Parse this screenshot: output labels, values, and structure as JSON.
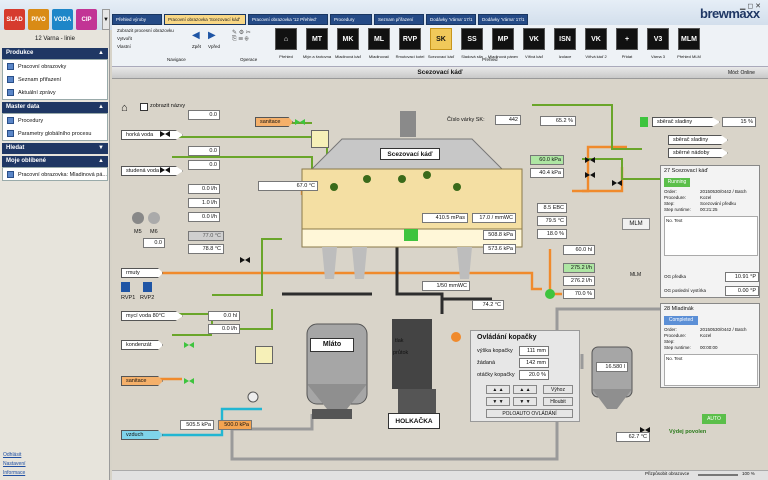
{
  "product_tabs": [
    {
      "label": "SLAD",
      "color": "#d63b2e"
    },
    {
      "label": "PIVO",
      "color": "#d98b16"
    },
    {
      "label": "VODA",
      "color": "#1e86c8"
    },
    {
      "label": "CIP",
      "color": "#c23495"
    }
  ],
  "product_tab_more": "▼",
  "sidebar": {
    "user": "12 Varna - linie",
    "production_header": "Produkce",
    "production_items": [
      "Pracovní obrazovky",
      "Seznam přiřazení",
      "Aktuální zprávy"
    ],
    "masterdata_header": "Master data",
    "masterdata_items": [
      "Procedury",
      "Parametry globálního procesu"
    ],
    "search_header": "Hledat",
    "favorites_header": "Moje oblíbené",
    "favorites_items": [
      "Pracovní obrazovka: Mladinová pá..."
    ],
    "links": [
      "Odhlásit",
      "Nastavení",
      "Informace"
    ]
  },
  "tabs": [
    "Přehled výroby",
    "Pracovní obrazovka 'Scezovací káď'",
    "Pracovní obrazovka '12 Přehled'",
    "Procedury",
    "Seznam přiřazení",
    "Dodávky 'Várna' 17/1",
    "Dodávky 'Várna' 17/1"
  ],
  "logo": "brewmaxx",
  "ribbon": {
    "left_items": [
      "Zobrazit procesní obrazovku",
      "Vytvořit",
      "Vlastní"
    ],
    "nav": {
      "back": "Zpět",
      "forward": "Vpřed"
    },
    "section_labels": [
      "Navigace",
      "Operace",
      "Přehled"
    ],
    "buttons": [
      {
        "icon": "⌂",
        "label": "Přehled"
      },
      {
        "icon": "MT",
        "label": "Mlýn a šrotovna"
      },
      {
        "icon": "MK",
        "label": "Mladinová káď"
      },
      {
        "icon": "ML",
        "label": "Mladinovač"
      },
      {
        "icon": "RVP",
        "label": "Rmutovací kotel"
      },
      {
        "icon": "SK",
        "label": "Scezovací káď"
      },
      {
        "icon": "SS",
        "label": "Sladová sila"
      },
      {
        "icon": "MP",
        "label": "Mladinová pánev"
      },
      {
        "icon": "VK",
        "label": "Vířivá káď"
      },
      {
        "icon": "ISN",
        "label": "Izolace"
      },
      {
        "icon": "VK",
        "label": "Vířivá káď 2"
      },
      {
        "icon": "+",
        "label": "Přidat"
      },
      {
        "icon": "V3",
        "label": "Várna 3"
      },
      {
        "icon": "MLM",
        "label": "Přehled MLM"
      }
    ],
    "active_index": 5
  },
  "panel": {
    "title": "Scezovací káď",
    "zoom_label": "Mód: Online"
  },
  "scada": {
    "show_names": "zobrazit názvy",
    "hot_water": "horká voda",
    "cold_water": "studená voda",
    "vessel_title": "Scezovací káď",
    "mash": "rmuty",
    "wash_water": "mycí voda 80°C",
    "condensate": "kondenzát",
    "sanitation": "sanitace",
    "sanitation2": "sanitace",
    "steam": "vzduch",
    "mlato": "Mláto",
    "holkacka": "HOLKAČKA",
    "rvp": [
      "RVP1",
      "RVP2"
    ],
    "m_labels": [
      "M5",
      "M6"
    ],
    "values": {
      "v_a": "0.0",
      "v_b": "0.0",
      "v_c": "0.0",
      "v_flow1": "0.0 l/h",
      "v_flow2": "1.0 l/h",
      "v_flow3": "0.0 l/h",
      "temp_grey": "77.0 °C",
      "temp2": "78.8 °C",
      "temp_top": "67.0 °C",
      "m6": "0.0",
      "steam_pct": "0.0",
      "pressure1": "410.5 mPas",
      "pressure2": "17.0 / mmWC",
      "kpa1": "508.8 kPa",
      "kpa2": "573.6 kPa",
      "sk_no_label": "Číslo várky SK:",
      "sk_no": "442",
      "pct1": "65.2 %",
      "kpa_green": "60.0 kPa",
      "kpa_green2": "40.4 kPa",
      "ebc": "8.5 EBC",
      "temp_c": "79.5 °C",
      "cent": "18.0 %",
      "hl1": "60.0 hl",
      "flow_green": "275.2 l/h",
      "flow2": "276.2 l/h",
      "pct2": "70.0 %",
      "temp_mid": "74.2 °C",
      "mmwc": "1/50 mmWC",
      "wash_val1": "0.0 hl",
      "wash_val2": "0.0 l/h",
      "kpa_blue": "505.5 kPa",
      "kpa_orange": "500.0 kPa",
      "tank_val": "16.580 l",
      "temp_bottom": "62.7 °C"
    },
    "rake": {
      "title": "Ovládání kopačky",
      "rows": [
        {
          "label": "výška kopačky",
          "value": "111 mm"
        },
        {
          "label": "žádaná",
          "value": "142 mm"
        },
        {
          "label": "otáčky kopačky",
          "value": "20.0 %"
        }
      ],
      "btn_up": "▲ ▲",
      "btn_down": "▼ ▼",
      "btn_auto": "POLOAUTO OVLÁDÁNÍ",
      "btn_vyhoz": "Výhoz",
      "btn_hloub": "Hloubit",
      "labels": [
        "tlak",
        "průtok"
      ]
    },
    "sender": {
      "label": "sběrač sladiny",
      "value": "15 %",
      "btn1": "sběrač sladiny",
      "btn2": "sběrné nádoby"
    },
    "mlm": "MLM",
    "batch1": {
      "title": "27 Scezovací káď",
      "status": "Running",
      "rows": [
        {
          "k": "Order:",
          "v": "20150530/0442 / Batch"
        },
        {
          "k": "Procedure:",
          "v": "Kozel"
        },
        {
          "k": "Step:",
          "v": "Scezování předku"
        },
        {
          "k": "Step runtime:",
          "v": "00:21:25"
        }
      ],
      "note_header": "No. Text",
      "og_label": "OG předka",
      "og_value": "10.91 °P",
      "og2_label": "OG poslední vystírka",
      "og2_value": "0.00 °P"
    },
    "batch2": {
      "title": "28 Mladinák",
      "status": "Completed",
      "rows": [
        {
          "k": "Order:",
          "v": "20150530/0442 / Batch"
        },
        {
          "k": "Procedure:",
          "v": "Kozel"
        },
        {
          "k": "Step:",
          "v": ""
        },
        {
          "k": "Step runtime:",
          "v": "00:00:00"
        }
      ],
      "note_header": "No. Text"
    },
    "auto": "AUTO",
    "vydej": "Výdej povolen"
  },
  "statusbar": {
    "zoom": "Přizpůsobit obrazovce",
    "pct": "100 %"
  },
  "colors": {
    "accent": "#1f3764",
    "green": "#3ec43e",
    "orange": "#f08a2c",
    "pipe": "#7a7a7a"
  }
}
